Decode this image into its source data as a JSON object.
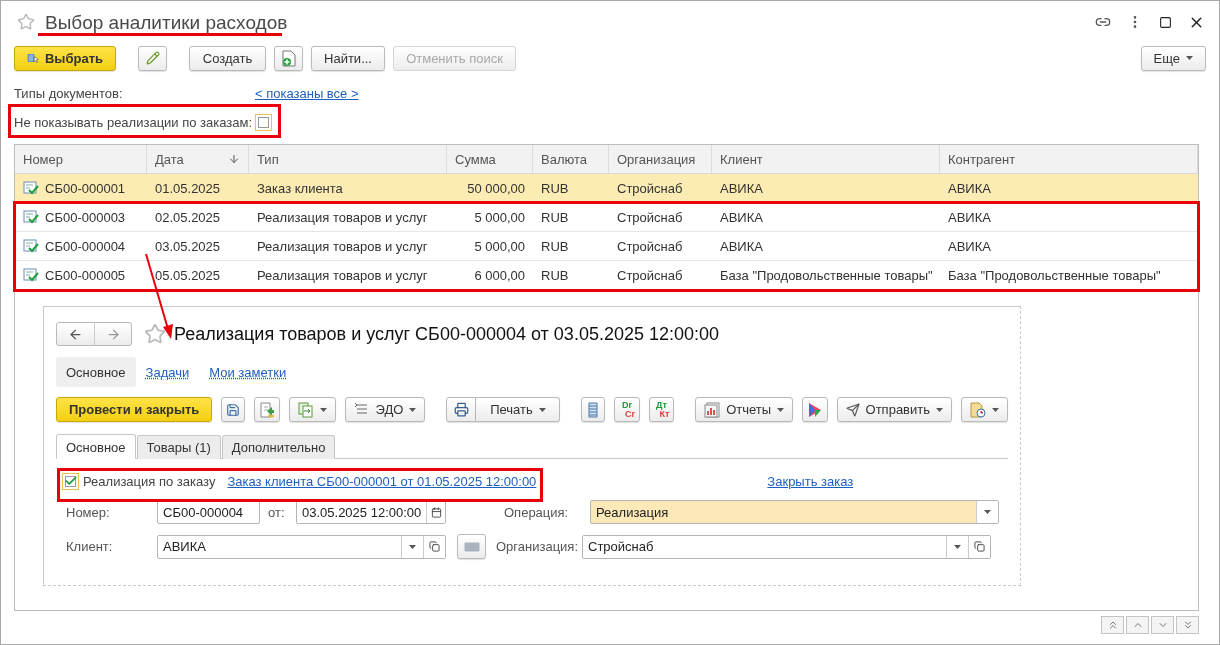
{
  "window": {
    "title": "Выбор аналитики расходов"
  },
  "toolbar": {
    "select_button": "Выбрать",
    "create_button": "Создать",
    "find_button": "Найти...",
    "cancel_search_button": {
      "label": "Отменить поиск",
      "disabled": true
    },
    "more_button": "Еще"
  },
  "filters": {
    "document_types_label": "Типы документов:",
    "document_types_link": "< показаны все >",
    "hide_sales_by_orders": {
      "label": "Не показывать реализации по заказам:",
      "checked": false
    }
  },
  "table": {
    "columns": [
      {
        "label": "Номер",
        "sorted": false
      },
      {
        "label": "Дата",
        "sorted": true
      },
      {
        "label": "Тип",
        "sorted": false
      },
      {
        "label": "Сумма",
        "sorted": false
      },
      {
        "label": "Валюта",
        "sorted": false
      },
      {
        "label": "Организация",
        "sorted": false
      },
      {
        "label": "Клиент",
        "sorted": false
      },
      {
        "label": "Контрагент",
        "sorted": false
      }
    ],
    "rows": [
      {
        "selected": true,
        "cells": [
          "СБ00-000001",
          "01.05.2025",
          "Заказ клиента",
          "50 000,00",
          "RUB",
          "Стройснаб",
          "АВИКА",
          "АВИКА"
        ]
      },
      {
        "selected": false,
        "cells": [
          "СБ00-000003",
          "02.05.2025",
          "Реализация товаров и услуг",
          "5 000,00",
          "RUB",
          "Стройснаб",
          "АВИКА",
          "АВИКА"
        ]
      },
      {
        "selected": false,
        "cells": [
          "СБ00-000004",
          "03.05.2025",
          "Реализация товаров и услуг",
          "5 000,00",
          "RUB",
          "Стройснаб",
          "АВИКА",
          "АВИКА"
        ]
      },
      {
        "selected": false,
        "cells": [
          "СБ00-000005",
          "05.05.2025",
          "Реализация товаров и услуг",
          "6 000,00",
          "RUB",
          "Стройснаб",
          "База \"Продовольственные товары\"",
          "База \"Продовольственные товары\""
        ]
      }
    ]
  },
  "inset": {
    "title": "Реализация товаров и услуг СБ00-000004 от 03.05.2025 12:00:00",
    "nav_tabs": [
      {
        "label": "Основное",
        "selected": true
      },
      {
        "label": "Задачи",
        "selected": false
      },
      {
        "label": "Мои заметки",
        "selected": false
      }
    ],
    "toolbar": {
      "post_close_button": "Провести и закрыть",
      "edo_button": "ЭДО",
      "print_button": "Печать",
      "dr_cr": [
        "Dr",
        "Cr"
      ],
      "dt_kt": [
        "Дт",
        "Кт"
      ],
      "reports_button": "Отчеты",
      "send_button": "Отправить"
    },
    "tabs": [
      {
        "label": "Основное",
        "selected": true
      },
      {
        "label": "Товары (1)",
        "selected": false
      },
      {
        "label": "Дополнительно",
        "selected": false
      }
    ],
    "by_order": {
      "label": "Реализация по заказу",
      "checked": true
    },
    "order_link": "Заказ клиента СБ00-000001 от 01.05.2025 12:00:00",
    "close_order_link": "Закрыть заказ",
    "fields": {
      "number": {
        "label": "Номер:",
        "value": "СБ00-000004"
      },
      "date": {
        "label": "от:",
        "value": "03.05.2025 12:00:00"
      },
      "operation": {
        "label": "Операция:",
        "value": "Реализация"
      },
      "client": {
        "label": "Клиент:",
        "value": "АВИКА"
      },
      "organization": {
        "label": "Организация:",
        "value": "Стройснаб"
      }
    }
  }
}
